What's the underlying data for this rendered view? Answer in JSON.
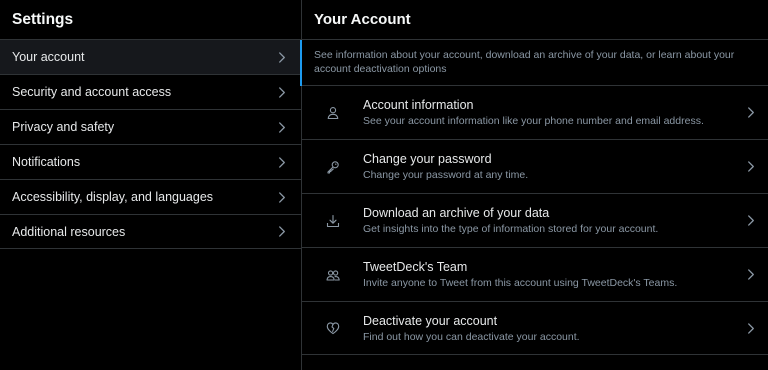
{
  "colors": {
    "background": "#000000",
    "active_item_bg": "#16181c",
    "divider": "#2f3336",
    "primary_text": "#e7e9ea",
    "secondary_text": "#8b98a5",
    "accent": "#1d9bf0"
  },
  "left": {
    "title": "Settings",
    "items": [
      {
        "label": "Your account",
        "active": true,
        "icon": "chevron-right-icon"
      },
      {
        "label": "Security and account access",
        "active": false,
        "icon": "chevron-right-icon"
      },
      {
        "label": "Privacy and safety",
        "active": false,
        "icon": "chevron-right-icon"
      },
      {
        "label": "Notifications",
        "active": false,
        "icon": "chevron-right-icon"
      },
      {
        "label": "Accessibility, display, and languages",
        "active": false,
        "icon": "chevron-right-icon"
      },
      {
        "label": "Additional resources",
        "active": false,
        "icon": "chevron-right-icon"
      }
    ]
  },
  "right": {
    "title": "Your Account",
    "intro": "See information about your account, download an archive of your data, or learn about your account deactivation options",
    "items": [
      {
        "icon": "person-icon",
        "title": "Account information",
        "description": "See your account information like your phone number and email address."
      },
      {
        "icon": "key-icon",
        "title": "Change your password",
        "description": "Change your password at any time."
      },
      {
        "icon": "download-icon",
        "title": "Download an archive of your data",
        "description": "Get insights into the type of information stored for your account."
      },
      {
        "icon": "people-icon",
        "title": "TweetDeck's Team",
        "description": "Invite anyone to Tweet from this account using TweetDeck's Teams."
      },
      {
        "icon": "broken-heart-icon",
        "title": "Deactivate your account",
        "description": "Find out how you can deactivate your account."
      }
    ]
  }
}
